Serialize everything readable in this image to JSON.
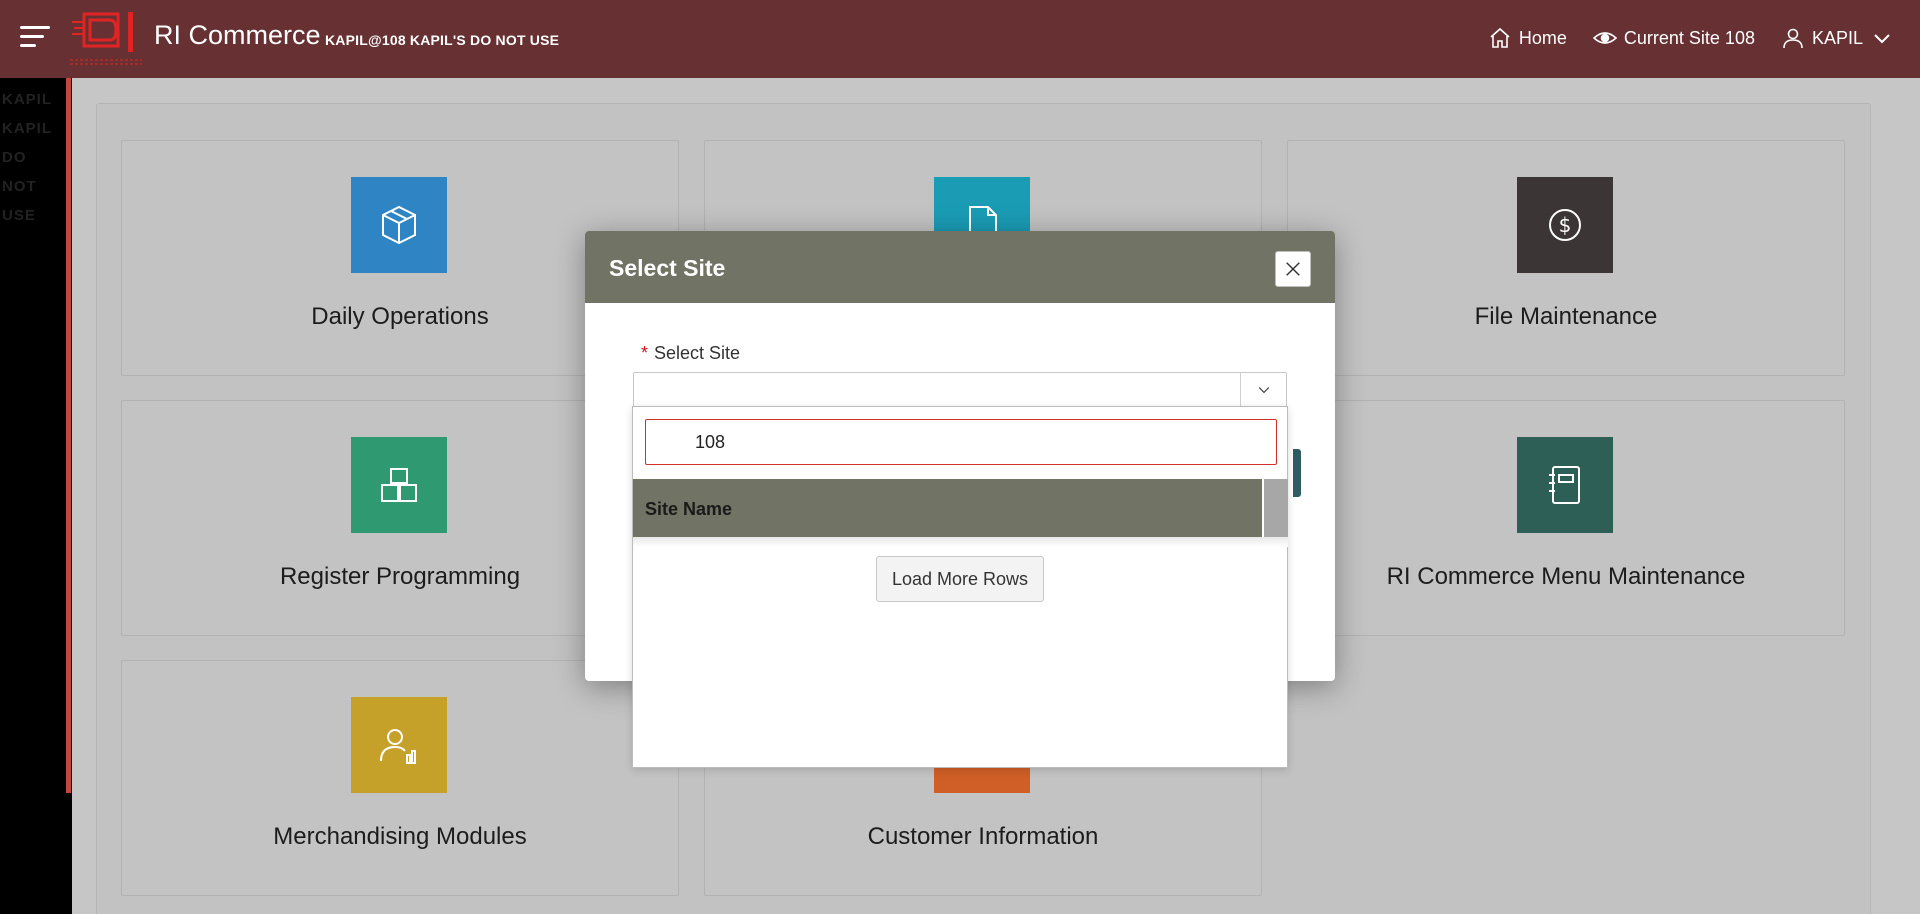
{
  "header": {
    "app_title": "RI Commerce",
    "app_subtitle": "KAPIL@108 KAPIL'S DO NOT USE",
    "logo_icon": "ri-commerce-logo-icon",
    "nav": {
      "home_label": "Home",
      "current_site_label": "Current Site 108",
      "user_label": "KAPIL"
    }
  },
  "sidebar": {
    "text": "KAPIL KAPIL DO NOT USE"
  },
  "cards": [
    {
      "label": "Daily Operations",
      "icon": "box-icon",
      "color": "#2f85c3"
    },
    {
      "label": "",
      "icon": "document-icon",
      "color": "#1a9cb5"
    },
    {
      "label": "File Maintenance",
      "icon": "dollar-icon",
      "color": "#3b3535"
    },
    {
      "label": "Register Programming",
      "icon": "blocks-icon",
      "color": "#2f9a72"
    },
    {
      "label": "RI Commerce Menu Maintenance",
      "icon": "notebook-icon",
      "color": "#2d5f57"
    },
    {
      "label": "Merchandising Modules",
      "icon": "user-chart-icon",
      "color": "#c6a12a"
    },
    {
      "label": "Customer Information",
      "icon": "",
      "color": "#cf5f27"
    }
  ],
  "modal": {
    "title": "Select Site",
    "field_label": "Select Site",
    "required_marker": "*",
    "field_value": ""
  },
  "popup": {
    "search_value": "108",
    "column_header": "Site Name",
    "load_more_label": "Load More Rows"
  },
  "colors": {
    "header_bg": "#673033",
    "overlay_bg": "#c6c6c6",
    "modal_header": "#717364",
    "required": "#d0121b"
  }
}
